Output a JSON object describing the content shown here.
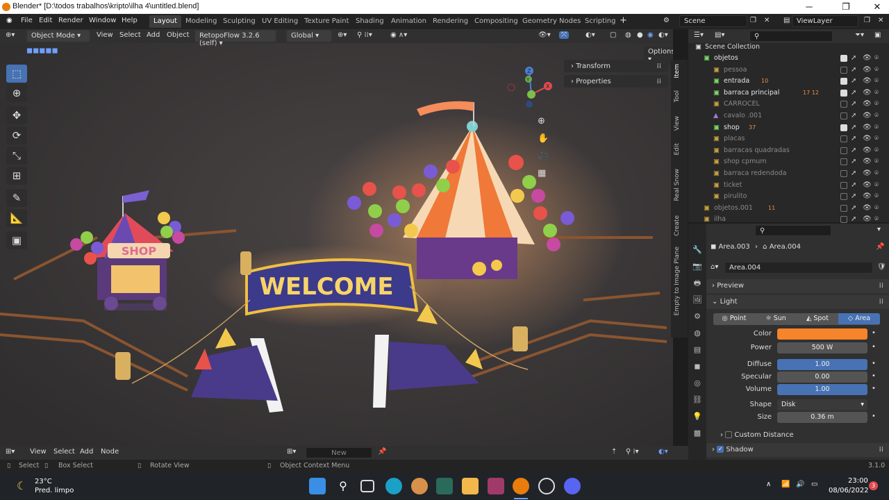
{
  "window": {
    "title": "Blender* [D:\\todos trabalhos\\kripto\\ilha 4\\untitled.blend]"
  },
  "menu": [
    "File",
    "Edit",
    "Render",
    "Window",
    "Help"
  ],
  "workspaces": [
    "Layout",
    "Modeling",
    "Sculpting",
    "UV Editing",
    "Texture Paint",
    "Shading",
    "Animation",
    "Rendering",
    "Compositing",
    "Geometry Nodes",
    "Scripting"
  ],
  "scene": "Scene",
  "view_layer": "ViewLayer",
  "viewport_header": {
    "mode": "Object Mode",
    "menus": [
      "View",
      "Select",
      "Add",
      "Object"
    ],
    "addon": "RetopoFlow 3.2.6 (self)",
    "orientation": "Global",
    "options": "Options"
  },
  "npanel": {
    "transform": "Transform",
    "properties": "Properties"
  },
  "side_tabs": [
    "Item",
    "Tool",
    "View",
    "Edit",
    "Real Snow",
    "Create",
    "Empty to Image Plane"
  ],
  "viewport_scene": {
    "sign": "WELCOME",
    "shop_sign": "SHOP"
  },
  "outliner": {
    "root": "Scene Collection",
    "rows": [
      {
        "name": "objetos",
        "level": 1,
        "type": "collection",
        "checked": true
      },
      {
        "name": "pessoa",
        "level": 2,
        "type": "collection",
        "checked": false
      },
      {
        "name": "entrada",
        "level": 2,
        "type": "collection",
        "checked": true,
        "badge": "10"
      },
      {
        "name": "barraca principal",
        "level": 2,
        "type": "collection",
        "checked": true,
        "badge": "17 12"
      },
      {
        "name": "CARROCEL",
        "level": 2,
        "type": "collection",
        "checked": false
      },
      {
        "name": "cavalo .001",
        "level": 2,
        "type": "object",
        "checked": false
      },
      {
        "name": "shop",
        "level": 2,
        "type": "collection",
        "checked": true,
        "badge": "37"
      },
      {
        "name": "placas",
        "level": 2,
        "type": "collection",
        "checked": false
      },
      {
        "name": "barracas quadradas",
        "level": 2,
        "type": "collection",
        "checked": false
      },
      {
        "name": "shop cpmum",
        "level": 2,
        "type": "collection",
        "checked": false
      },
      {
        "name": "barraca redendoda",
        "level": 2,
        "type": "collection",
        "checked": false
      },
      {
        "name": "ticket",
        "level": 2,
        "type": "collection",
        "checked": false
      },
      {
        "name": "pirulito",
        "level": 2,
        "type": "collection",
        "checked": false
      },
      {
        "name": "objetos.001",
        "level": 1,
        "type": "collection",
        "checked": false,
        "badge": "11"
      },
      {
        "name": "ilha",
        "level": 1,
        "type": "collection",
        "checked": false
      }
    ]
  },
  "properties": {
    "breadcrumb_object": "Area.003",
    "breadcrumb_data": "Area.004",
    "datablock": "Area.004",
    "sections": {
      "preview": "Preview",
      "light": "Light",
      "custom_distance": "Custom Distance",
      "shadow": "Shadow"
    },
    "light_types": [
      "Point",
      "Sun",
      "Spot",
      "Area"
    ],
    "active_type": "Area",
    "color_label": "Color",
    "color": "#f5842a",
    "fields": [
      {
        "label": "Power",
        "value": "500 W",
        "style": "grey"
      },
      {
        "label": "Diffuse",
        "value": "1.00",
        "style": "blue"
      },
      {
        "label": "Specular",
        "value": "0.00",
        "style": "grey"
      },
      {
        "label": "Volume",
        "value": "1.00",
        "style": "blue"
      }
    ],
    "shape_label": "Shape",
    "shape": "Disk",
    "size_label": "Size",
    "size": "0.36 m"
  },
  "bottom_editor": {
    "menus": [
      "View",
      "Select",
      "Add",
      "Node"
    ],
    "new_button": "New"
  },
  "status": {
    "select": "Select",
    "box_select": "Box Select",
    "rotate": "Rotate View",
    "context": "Object Context Menu",
    "version": "3.1.0"
  },
  "taskbar": {
    "temp": "23°C",
    "weather": "Pred. limpo",
    "time": "23:00",
    "date": "08/06/2022"
  }
}
